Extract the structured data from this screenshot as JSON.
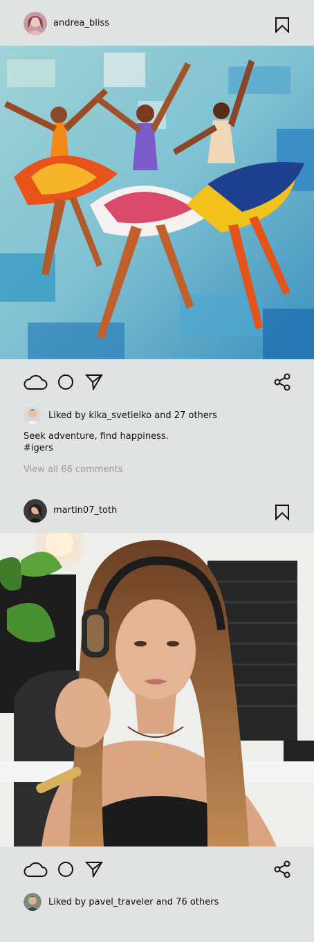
{
  "posts": [
    {
      "username": "andrea_bliss",
      "avatar_icon": "user-avatar",
      "image_alt": "painting",
      "liked_by_user": "kika_svetielko",
      "likes_others": "27 others",
      "likes_text": "Liked by kika_svetielko and 27 others",
      "caption_line1": "Seek adventure, find happiness.",
      "caption_line2": "#igers",
      "view_comments": "View all 66 comments"
    },
    {
      "username": "martin07_toth",
      "avatar_icon": "user-avatar",
      "image_alt": "photo",
      "liked_by_user": "pavel_traveler",
      "likes_others": "76 others",
      "likes_text": "Liked by pavel_traveler and 76 others"
    }
  ],
  "icons": {
    "bookmark": "bookmark-icon",
    "like": "cloud-icon",
    "comment": "circle-icon",
    "send": "send-icon",
    "share": "share-icon"
  },
  "colors": {
    "background": "#e1e3e2",
    "text": "#111111",
    "muted": "#999999"
  }
}
